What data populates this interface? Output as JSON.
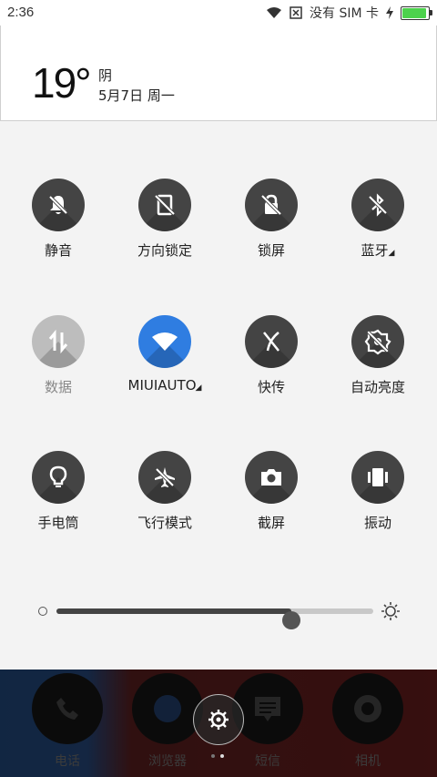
{
  "status": {
    "time": "2:36",
    "carrier": "没有 SIM 卡"
  },
  "weather": {
    "temperature": "19°",
    "condition": "阴",
    "date": "5月7日 周一"
  },
  "toggles": [
    {
      "label": "静音",
      "icon": "mute-bell-icon"
    },
    {
      "label": "方向锁定",
      "icon": "rotation-lock-icon"
    },
    {
      "label": "锁屏",
      "icon": "lock-screen-icon"
    },
    {
      "label": "蓝牙",
      "icon": "bluetooth-icon"
    },
    {
      "label": "数据",
      "icon": "mobile-data-icon"
    },
    {
      "label": "MIUIAUTO",
      "icon": "wifi-icon"
    },
    {
      "label": "快传",
      "icon": "quick-transfer-icon"
    },
    {
      "label": "自动亮度",
      "icon": "auto-brightness-icon"
    },
    {
      "label": "手电筒",
      "icon": "flashlight-icon"
    },
    {
      "label": "飞行模式",
      "icon": "airplane-icon"
    },
    {
      "label": "截屏",
      "icon": "screenshot-camera-icon"
    },
    {
      "label": "振动",
      "icon": "vibrate-icon"
    }
  ],
  "brightness": {
    "level_percent": 74
  },
  "dock": [
    {
      "label": "电话",
      "icon": "phone-icon"
    },
    {
      "label": "浏览器",
      "icon": "browser-icon"
    },
    {
      "label": "短信",
      "icon": "messages-icon"
    },
    {
      "label": "相机",
      "icon": "camera-icon"
    }
  ],
  "colors": {
    "accent": "#2f7de1",
    "toggle_on": "#444444",
    "toggle_off": "#bdbdbd",
    "battery": "#4cd24c"
  }
}
